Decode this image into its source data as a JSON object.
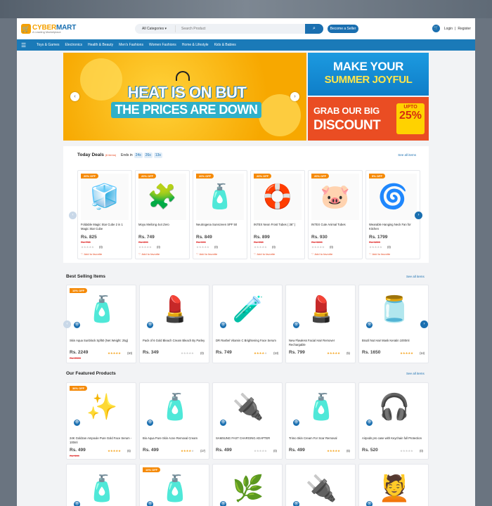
{
  "brand": {
    "name_a": "CYBER",
    "name_b": "MART",
    "tagline": "A Leading Marketplace"
  },
  "search": {
    "category": "All Categories",
    "placeholder": "Search Product"
  },
  "header": {
    "become_seller": "Become a Seller",
    "login": "Login",
    "register": "Register"
  },
  "nav": [
    "Toys & Games",
    "Electronics",
    "Health & Beauty",
    "Men's Fashions",
    "Women Fashions",
    "Home & Lifestyle",
    "Kids & Babies"
  ],
  "banner": {
    "main_line1": "HEAT IS ON BUT",
    "main_line2": "THE PRICES ARE DOWN",
    "top_line1": "MAKE YOUR",
    "top_line2": "SUMMER JOYFUL",
    "bot_line1": "GRAB OUR BIG",
    "bot_line2": "DISCOUNT",
    "upto": "UPTO",
    "percent": "25%"
  },
  "today_deals": {
    "title": "Today Deals",
    "count": "(6 items)",
    "ends_in": "Ends in",
    "timer": [
      "24s",
      "26s",
      "13s"
    ],
    "see_all": "See all items",
    "items": [
      {
        "badge": "20% OFF",
        "name": "Foldable Magic Star Cube 2 in 1 Magic Star Cube",
        "price": "Rs. 825",
        "old": "Rs. 750",
        "rating": 0,
        "reviews": "(0)",
        "fav": "Add to favorite",
        "emoji": "🧊"
      },
      {
        "badge": "20% OFF",
        "name": "Moyu Meilong 4x4 Zero",
        "price": "Rs. 749",
        "old": "Rs. 899",
        "rating": 0,
        "reviews": "(0)",
        "fav": "Add to favorite",
        "emoji": "🧩"
      },
      {
        "badge": "20% OFF",
        "name": "Neutrogena Sunscreen SPF 50",
        "price": "Rs. 849",
        "old": "Rs. 999",
        "rating": 0,
        "reviews": "(0)",
        "fav": "Add to favorite",
        "emoji": "🧴"
      },
      {
        "badge": "20% OFF",
        "name": "INTEX Neon Frost Tubes ( 36\" )",
        "price": "Rs. 899",
        "old": "Rs. 950",
        "rating": 0,
        "reviews": "(0)",
        "fav": "Add to favorite",
        "emoji": "🛟"
      },
      {
        "badge": "20% OFF",
        "name": "INTEX Cute Animal Tubes",
        "price": "Rs. 930",
        "old": "Rs. 1100",
        "rating": 0,
        "reviews": "(0)",
        "fav": "Add to favorite",
        "emoji": "🐷"
      },
      {
        "badge": "5% OFF",
        "name": "Wearable Hanging Neck Fan for Kitchen",
        "price": "Rs. 1799",
        "old": "Rs. 1899",
        "rating": 0,
        "reviews": "(0)",
        "fav": "Add to favorite",
        "emoji": "🌀"
      }
    ]
  },
  "best_selling": {
    "title": "Best Selling Items",
    "see_all": "See all items",
    "items": [
      {
        "badge": "10% OFF",
        "name": "Skin Aqua Sunblock Spf50 (Net Weight: 25g)",
        "price": "Rs. 2249",
        "old": "Rs. 2599",
        "rating": 5,
        "reviews": "(10)",
        "emoji": "🧴"
      },
      {
        "badge": "",
        "name": "Pack of 6 Gold Bleach Cream Bleach By Parley",
        "price": "Rs. 349",
        "old": "",
        "rating": 0,
        "reviews": "(0)",
        "emoji": "💄"
      },
      {
        "badge": "",
        "name": "DR Rashel Vitamin C Brightening Face Serum",
        "price": "Rs. 749",
        "old": "",
        "rating": 4,
        "reviews": "(13)",
        "emoji": "🧪"
      },
      {
        "badge": "",
        "name": "New Flawless Facial Hair Remover Rechargable",
        "price": "Rs. 799",
        "old": "",
        "rating": 5,
        "reviews": "(5)",
        "emoji": "💄"
      },
      {
        "badge": "",
        "name": "Brazil Nut Hair Mask Keratin 1000ml",
        "price": "Rs. 1650",
        "old": "",
        "rating": 5,
        "reviews": "(14)",
        "emoji": "🫙"
      }
    ]
  },
  "featured": {
    "title": "Our Featured Products",
    "see_all": "See all items",
    "items": [
      {
        "badge": "36% OFF",
        "name": "24K Goldzan Ampoule Pure Gold Face Serum - 100ml",
        "price": "Rs. 499",
        "old": "Rs. 599",
        "rating": 5,
        "reviews": "(6)",
        "emoji": "✨"
      },
      {
        "badge": "",
        "name": "Bio Aqua Pure Skin Acne Removal Cream",
        "price": "Rs. 499",
        "old": "",
        "rating": 4,
        "reviews": "(17)",
        "emoji": "🧴"
      },
      {
        "badge": "",
        "name": "SAMSUNG FAST CHARGING ADAPTER",
        "price": "Rs. 499",
        "old": "",
        "rating": 0,
        "reviews": "(0)",
        "emoji": "🔌"
      },
      {
        "badge": "",
        "name": "Trimo Skin Cream For Scar Removal",
        "price": "Rs. 499",
        "old": "",
        "rating": 5,
        "reviews": "(6)",
        "emoji": "🧴"
      },
      {
        "badge": "",
        "name": "Airpods pro case with Keychain full Protection",
        "price": "Rs. 520",
        "old": "",
        "rating": 0,
        "reviews": "(0)",
        "emoji": "🎧"
      }
    ],
    "row2": [
      {
        "badge": "",
        "emoji": "🧴"
      },
      {
        "badge": "10% OFF",
        "emoji": "🧴"
      },
      {
        "badge": "",
        "emoji": "🌿"
      },
      {
        "badge": "",
        "emoji": "🔌"
      },
      {
        "badge": "",
        "emoji": "💆"
      }
    ]
  },
  "colors": {
    "primary": "#1a6fb0",
    "accent": "#f58a07",
    "nav": "#1a7ab8"
  }
}
